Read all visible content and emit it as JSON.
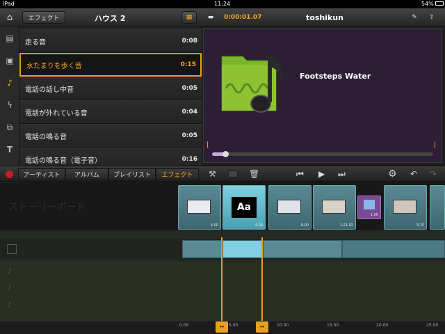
{
  "status": {
    "carrier": "iPad",
    "time": "11:24",
    "battery": "54%"
  },
  "header": {
    "back_label": "エフェクト",
    "project_title": "ハウス 2",
    "timecode": "0:00:01.07",
    "user": "toshikun"
  },
  "sidebar": {
    "icons": [
      "film-icon",
      "photo-icon",
      "music-icon",
      "lightning-icon",
      "transition-icon",
      "title-icon"
    ]
  },
  "sound_list": [
    {
      "name": "走る音",
      "duration": "0:08"
    },
    {
      "name": "水たまりを歩く音",
      "duration": "0:15",
      "selected": true
    },
    {
      "name": "電話の話し中音",
      "duration": "0:05"
    },
    {
      "name": "電話が外れている音",
      "duration": "0:04"
    },
    {
      "name": "電話の鳴る音",
      "duration": "0:05"
    },
    {
      "name": "電話の鳴る音（電子音）",
      "duration": "0:16"
    }
  ],
  "preview": {
    "track_title": "Footsteps Water",
    "playback_fraction": 0.06
  },
  "tabs": [
    {
      "label": "アーティスト"
    },
    {
      "label": "アルバム"
    },
    {
      "label": "プレイリスト"
    },
    {
      "label": "エフェクト",
      "active": true
    }
  ],
  "storyboard": {
    "watermark": "ストーリーボード",
    "clips": [
      {
        "duration": "4.00"
      },
      {
        "duration": "4.00",
        "title_glyph": "Aa"
      },
      {
        "duration": "8.00"
      },
      {
        "duration": "1:21.02"
      },
      {
        "duration": "1.00"
      },
      {
        "duration": "3.15"
      }
    ]
  },
  "ruler": {
    "ticks": [
      "0.00",
      "5.00",
      "10.00",
      "15.00",
      "20.00",
      "25.00"
    ]
  },
  "colors": {
    "accent": "#f4a720",
    "preview_bg": "#2c1e35",
    "clip": "#4a7a85"
  }
}
